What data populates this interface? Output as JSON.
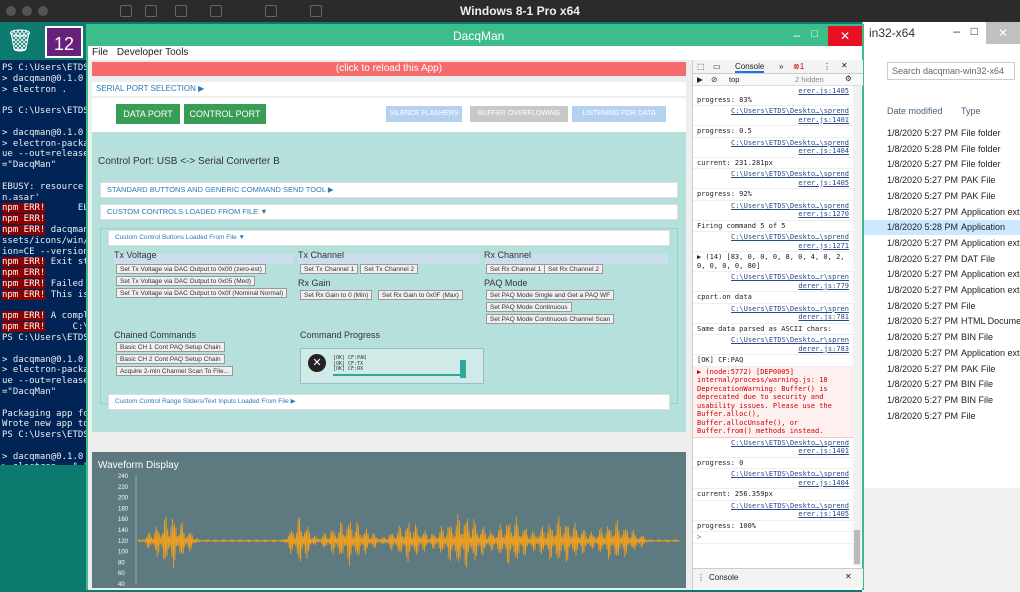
{
  "topbar": {
    "title": "Windows 8-1 Pro x64"
  },
  "powershell": {
    "lines": [
      "PS C:\\Users\\ETDS\\De",
      "> dacqman@0.1.0 sta",
      "> electron .",
      "",
      "PS C:\\Users\\ETDS\\De",
      "",
      "> dacqman@0.1.0 pac",
      "> electron-packager",
      "ue --out=release-bu",
      "=\"DacqMan\"",
      "",
      "EBUSY: resource bus",
      "n.asar'",
      "npm ERR!      ELIFE",
      "npm ERR!        1",
      "npm ERR! dacqman@0.",
      "ssets/icons/win/ico",
      "ion=CE --version-st",
      "npm ERR! Exit statu",
      "npm ERR!",
      "npm ERR! Failed at",
      "npm ERR! This is pr",
      "",
      "npm ERR! A complete",
      "npm ERR!     C:\\Use",
      "PS C:\\Users\\ETDS\\De",
      "",
      "> dacqman@0.1.0 pac",
      "> electron-packager",
      "ue --out=release-bu",
      "=\"DacqMan\"",
      "",
      "Packaging app for p",
      "Wrote new app to re",
      "PS C:\\Users\\ETDS\\De",
      "",
      "> dacqman@0.1.0 sta",
      "> electron . \".\"",
      "",
      "> dacqman@0.1.0 pac",
      "> electron-packager",
      "ue --out=release-bu",
      "=\"DacqMan\"",
      "",
      "Packaging app for p",
      "Wrote new app to re",
      "PS C:\\Users\\ETDS\\De"
    ]
  },
  "explorer": {
    "title": "in32-x64",
    "search": "Search dacqman-win32-x64",
    "col_modified": "Date modified",
    "col_type": "Type",
    "rows": [
      [
        "1/8/2020 5:27 PM",
        "File folder"
      ],
      [
        "1/8/2020 5:28 PM",
        "File folder"
      ],
      [
        "1/8/2020 5:27 PM",
        "File folder"
      ],
      [
        "1/8/2020 5:27 PM",
        "PAK File"
      ],
      [
        "1/8/2020 5:27 PM",
        "PAK File"
      ],
      [
        "1/8/2020 5:27 PM",
        "Application extens"
      ],
      [
        "1/8/2020 5:28 PM",
        "Application"
      ],
      [
        "1/8/2020 5:27 PM",
        "Application extens"
      ],
      [
        "1/8/2020 5:27 PM",
        "DAT File"
      ],
      [
        "1/8/2020 5:27 PM",
        "Application extens"
      ],
      [
        "1/8/2020 5:27 PM",
        "Application extens"
      ],
      [
        "1/8/2020 5:27 PM",
        "File"
      ],
      [
        "1/8/2020 5:27 PM",
        "HTML Document"
      ],
      [
        "1/8/2020 5:27 PM",
        "BIN File"
      ],
      [
        "1/8/2020 5:27 PM",
        "Application extens"
      ],
      [
        "1/8/2020 5:27 PM",
        "PAK File"
      ],
      [
        "1/8/2020 5:27 PM",
        "BIN File"
      ],
      [
        "1/8/2020 5:27 PM",
        "BIN File"
      ],
      [
        "1/8/2020 5:27 PM",
        "File"
      ]
    ]
  },
  "dacq": {
    "title": "DacqMan",
    "menu": [
      "File",
      "Developer Tools"
    ],
    "reload": "(click to reload this App)",
    "serial_header": "SERIAL PORT SELECTION ▶",
    "data_port": "DATA PORT",
    "control_port": "CONTROL PORT",
    "silence": "SILENCE FLASHERS",
    "overflow": "BUFFER OVERFLOWING",
    "listening": "LISTENING FOR DATA",
    "control_port_label": "Control Port:  USB <-> Serial Converter B",
    "std_buttons": "STANDARD BUTTONS AND GENERIC COMMAND SEND TOOL ▶",
    "custom_controls": "CUSTOM CONTROLS LOADED FROM FILE ▼",
    "custom_buttons": "Custom Control Buttons Loaded From File ▼",
    "tx_voltage": "Tx Voltage",
    "tx_channel": "Tx Channel",
    "rx_channel": "Rx Channel",
    "rx_gain": "Rx Gain",
    "paq_mode": "PAQ Mode",
    "chained": "Chained Commands",
    "progress": "Command Progress",
    "btns": {
      "txv0": "Set Tx Voltage via DAC Output to 0x00 (zero-est)",
      "txv5": "Set Tx Voltage via DAC Output to 0x05 (Med)",
      "txvf": "Set Tx Voltage via DAC Output to 0x0f (Nominal Normal)",
      "txc1": "Set Tx Channel 1",
      "txc2": "Set Tx Channel 2",
      "rxc1": "Set Rx Channel 1",
      "rxc2": "Set Rx Channel 2",
      "rxg0": "Set Rx Gain to 0 (Min)",
      "rxgf": "Set Rx Gain to 0x0F (Max)",
      "paq1": "Set PAQ Mode Single and Get a PAQ WF",
      "paqc": "Set PAQ Mode Continuous",
      "paqs": "Set PAQ Mode Continuous Channel Scan",
      "ch1": "Basic CH 1 Cont PAQ Setup Chain",
      "ch2": "Basic CH 2 Cont PAQ Setup Chain",
      "acq": "Acquire 2-min Channel Scan To File..."
    },
    "prog_text": "[OK] CF:PAQ\n[OK] CF:TX\n[OK] CF:RX",
    "range_header": "Custom Control Range Sliders/Text Inputs Loaded From File ▶",
    "wave_title": "Waveform Display"
  },
  "chart_data": {
    "type": "line",
    "title": "Waveform Display",
    "yticks": [
      240,
      220,
      200,
      180,
      160,
      140,
      120,
      100,
      80,
      60,
      40
    ]
  },
  "devtools": {
    "console_tab": "Console",
    "errors": "1",
    "filter": "top",
    "hidden": "2 hidden",
    "drawer": "Console",
    "logs": [
      {
        "t": "progress: 83%",
        "s": "erer.js:1405"
      },
      {
        "t": "",
        "s": "C:\\Users\\ETDS\\Deskto…\\sprend erer.js:1401"
      },
      {
        "t": "progress: 0.5",
        "s": ""
      },
      {
        "t": "",
        "s": "C:\\Users\\ETDS\\Deskto…\\sprend erer.js:1404"
      },
      {
        "t": "current: 231.281px",
        "s": ""
      },
      {
        "t": "",
        "s": "C:\\Users\\ETDS\\Deskto…\\sprend erer.js:1405"
      },
      {
        "t": "progress: 92%",
        "s": ""
      },
      {
        "t": "",
        "s": "C:\\Users\\ETDS\\Deskto…\\sprend erer.js:1270"
      },
      {
        "t": "Firing command 5 of 5",
        "s": ""
      },
      {
        "t": "",
        "s": "C:\\Users\\ETDS\\Deskto…\\sprend erer.js:1271"
      },
      {
        "t": "▶ (14) [83, 0, 0, 0, 8, 0, 4, 0, 2, 0, 0, 0, 0, 80]",
        "s": ""
      },
      {
        "t": "",
        "s": "C:\\Users\\ETDS\\Deskto…r\\spren derer.js:779"
      },
      {
        "t": "cport.on data",
        "s": ""
      },
      {
        "t": "",
        "s": "C:\\Users\\ETDS\\Deskto…r\\spren derer.js:781"
      },
      {
        "t": "Same data parsed as ASCII chars:",
        "s": ""
      },
      {
        "t": "",
        "s": "C:\\Users\\ETDS\\Deskto…r\\spren derer.js:783"
      },
      {
        "t": "[OK] CF:PAQ",
        "s": ""
      }
    ],
    "warn": "▶ (node:5772) [DEP0005] internal/process/warning.js: 18 DeprecationWarning: Buffer() is deprecated due to security and usability issues. Please use the Buffer.alloc(), Buffer.allocUnsafe(), or Buffer.from() methods instead.",
    "logs2": [
      {
        "t": "",
        "s": "C:\\Users\\ETDS\\Deskto…\\sprend erer.js:1401"
      },
      {
        "t": "progress: 0",
        "s": ""
      },
      {
        "t": "",
        "s": "C:\\Users\\ETDS\\Deskto…\\sprend erer.js:1404"
      },
      {
        "t": "current: 256.359px",
        "s": ""
      },
      {
        "t": "",
        "s": "C:\\Users\\ETDS\\Deskto…\\sprend erer.js:1405"
      },
      {
        "t": "progress: 100%",
        "s": ""
      }
    ]
  }
}
